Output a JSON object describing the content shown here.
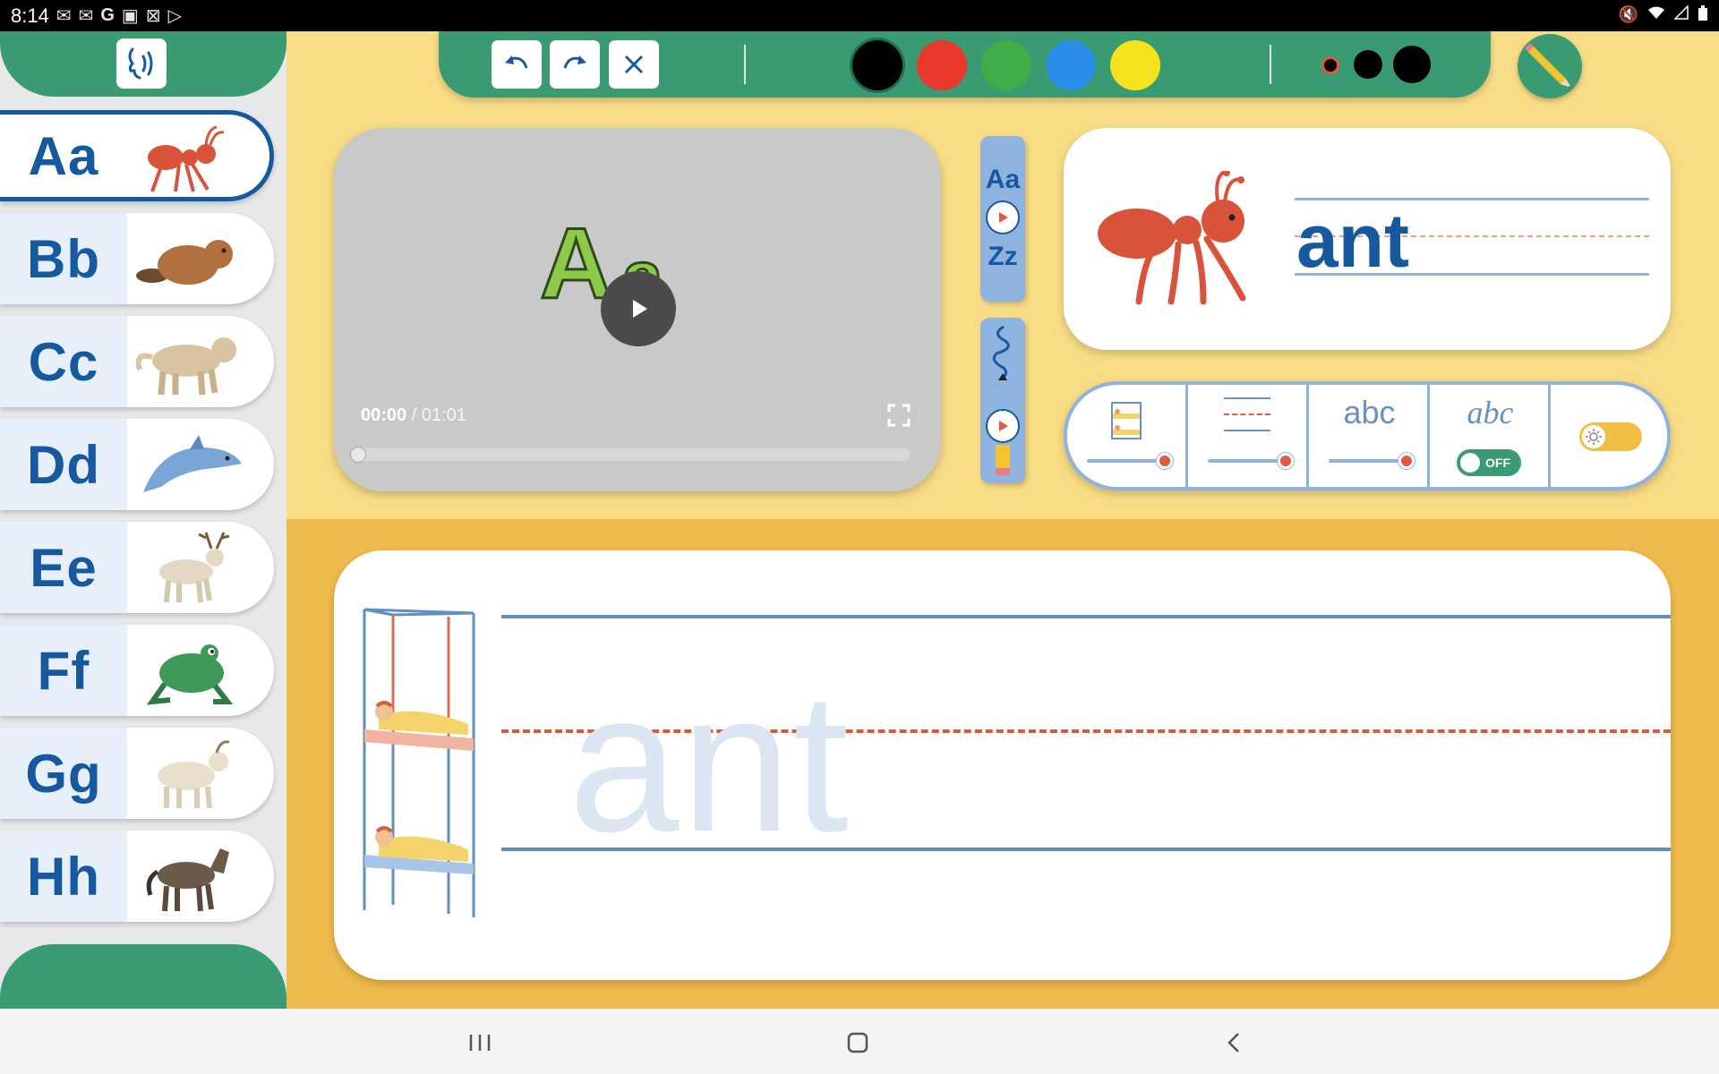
{
  "status_bar": {
    "time": "8:14",
    "left_icons": [
      "gmail-icon",
      "gmail-icon",
      "google-icon",
      "image-icon",
      "close-box-icon",
      "play-store-icon"
    ],
    "right_icons": [
      "mute-icon",
      "wifi-icon",
      "signal-icon",
      "battery-icon"
    ]
  },
  "sidebar": {
    "sound_icon": "speak-icon",
    "letters": [
      {
        "label": "Aa",
        "animal": "ant",
        "selected": true
      },
      {
        "label": "Bb",
        "animal": "beaver",
        "selected": false
      },
      {
        "label": "Cc",
        "animal": "cougar",
        "selected": false
      },
      {
        "label": "Dd",
        "animal": "dolphin",
        "selected": false
      },
      {
        "label": "Ee",
        "animal": "elk",
        "selected": false
      },
      {
        "label": "Ff",
        "animal": "frog",
        "selected": false
      },
      {
        "label": "Gg",
        "animal": "goat",
        "selected": false
      },
      {
        "label": "Hh",
        "animal": "horse",
        "selected": false
      }
    ]
  },
  "toolbar": {
    "buttons": [
      "undo-icon",
      "redo-icon",
      "close-icon"
    ],
    "colors": [
      "#000000",
      "#e8392b",
      "#3fae49",
      "#2b8fe8",
      "#f4e21c"
    ],
    "selected_color": "#000000",
    "pen_sizes": [
      "small",
      "medium",
      "large"
    ],
    "selected_pen_size": "small"
  },
  "video": {
    "current_time": "00:00",
    "duration": "/ 01:01",
    "progress": 0,
    "thumbnail_letters": [
      "A",
      "a"
    ]
  },
  "side_panels": {
    "alphabet": {
      "top": "Aa",
      "bottom": "Zz"
    }
  },
  "word_card": {
    "word": "ant",
    "image": "ant"
  },
  "settings": {
    "abc_label": "abc",
    "cursive_label": "abc",
    "cursive_toggle": "OFF",
    "slider_levels": [
      1,
      1,
      1
    ]
  },
  "writing": {
    "trace_word": "ant",
    "example_image": "bunk-bed"
  },
  "colors": {
    "green": "#3a9a72",
    "blue": "#17599e",
    "yellow_bg": "#f9dd86",
    "orange_bg": "#f0bb4e"
  }
}
